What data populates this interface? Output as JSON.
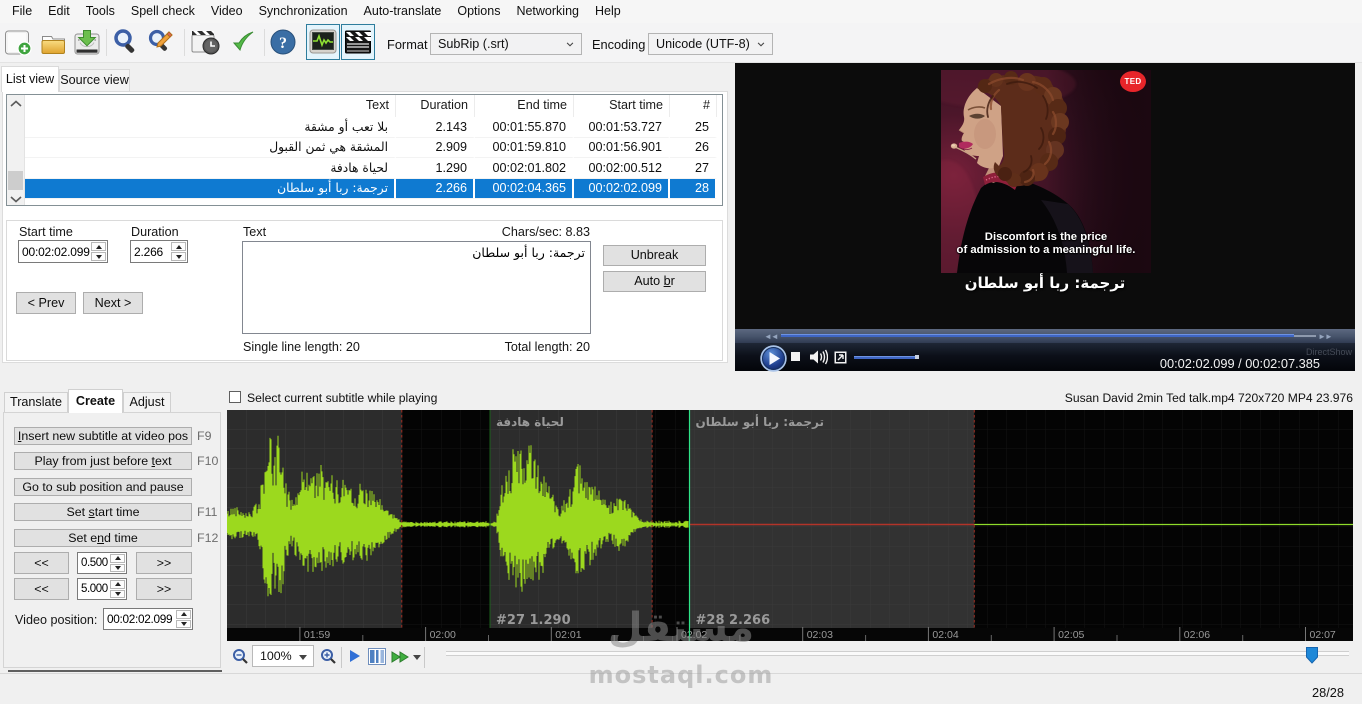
{
  "menu": {
    "items": [
      "File",
      "Edit",
      "Tools",
      "Spell check",
      "Video",
      "Synchronization",
      "Auto-translate",
      "Options",
      "Networking",
      "Help"
    ]
  },
  "toolbar": {
    "format_label": "Format",
    "format_value": "SubRip (.srt)",
    "encoding_label": "Encoding",
    "encoding_value": "Unicode (UTF-8)"
  },
  "view_tabs": {
    "list": "List view",
    "source": "Source view"
  },
  "listview": {
    "columns": [
      "Text",
      "Duration",
      "End time",
      "Start time",
      "#"
    ],
    "rows": [
      {
        "text": "بلا تعب أو مشقة",
        "duration": "2.143",
        "end": "00:01:55.870",
        "start": "00:01:53.727",
        "num": "25",
        "selected": false
      },
      {
        "text": "المشقة هي ثمن القبول",
        "duration": "2.909",
        "end": "00:01:59.810",
        "start": "00:01:56.901",
        "num": "26",
        "selected": false
      },
      {
        "text": "لحياة هادفة",
        "duration": "1.290",
        "end": "00:02:01.802",
        "start": "00:02:00.512",
        "num": "27",
        "selected": false
      },
      {
        "text": "ترجمة: ربا أبو سلطان",
        "duration": "2.266",
        "end": "00:02:04.365",
        "start": "00:02:02.099",
        "num": "28",
        "selected": true
      }
    ]
  },
  "editor": {
    "start_time_label": "Start time",
    "start_time": "00:02:02.099",
    "duration_label": "Duration",
    "duration": "2.266",
    "text_label": "Text",
    "chars_per_sec": "Chars/sec: 8.83",
    "text_value": "ترجمة: ربا أبو سلطان",
    "unbreak_label": "Unbreak",
    "auto_br_label": "Auto &br",
    "prev_label": "< Prev",
    "next_label": "Next >",
    "single_line_length": "Single line length: 20",
    "total_length": "Total length: 20"
  },
  "video": {
    "ted_logo": "TED",
    "caption_line1": "Discomfort is the price",
    "caption_line2": "of admission to a meaningful life.",
    "subtitle": "ترجمة: ربا أبو سلطان",
    "rewind_glyph": "◄◄",
    "forward_glyph": "►►",
    "time": "00:02:02.099 / 00:02:07.385",
    "renderer": "DirectShow",
    "progress_fraction": 0.959
  },
  "bottom_tabs": {
    "translate": "Translate",
    "create": "Create",
    "adjust": "Adjust"
  },
  "create_panel": {
    "buttons": [
      {
        "label": "&Insert new subtitle at video pos",
        "key": "F9"
      },
      {
        "label": "Play from just before &text",
        "key": "F10"
      },
      {
        "label": "Go to sub position and pause",
        "key": ""
      },
      {
        "label": "Set &start time",
        "key": "F11"
      },
      {
        "label": "Set e&nd time",
        "key": "F12"
      }
    ],
    "rewind_label": "<<",
    "forward_label": ">>",
    "small_step": "0.500",
    "big_step": "5.000",
    "video_position_label": "Video position:",
    "video_position": "00:02:02.099"
  },
  "wave": {
    "checkbox_label": "Select current subtitle while playing",
    "file_info": "Susan David 2min Ted talk.mp4 720x720 MP4 23.976",
    "zoom_value": "100%",
    "pixels_per_second": 125.7,
    "view_start_seconds": 118.42,
    "position_seconds": 122.099,
    "regions": [
      {
        "num": 26,
        "t_start": 116.901,
        "t_end": 119.81,
        "label": "",
        "info": "",
        "selected": false
      },
      {
        "num": 27,
        "t_start": 120.512,
        "t_end": 121.802,
        "label": "لحياة هادفة",
        "info": "#27  1.290",
        "selected": false
      },
      {
        "num": 28,
        "t_start": 122.099,
        "t_end": 124.365,
        "label": "ترجمة: ربا أبو سلطان",
        "info": "#28  2.266",
        "selected": true
      }
    ],
    "ticks": [
      {
        "t": 119,
        "label": "01:59"
      },
      {
        "t": 120,
        "label": "02:00"
      },
      {
        "t": 121,
        "label": "02:01"
      },
      {
        "t": 122,
        "label": "02:02"
      },
      {
        "t": 123,
        "label": "02:03"
      },
      {
        "t": 124,
        "label": "02:04"
      },
      {
        "t": 125,
        "label": "02:05"
      },
      {
        "t": 126,
        "label": "02:06"
      },
      {
        "t": 127,
        "label": "02:07"
      }
    ]
  },
  "status": {
    "count": "28/28"
  },
  "icons": {
    "help_glyph": "?"
  },
  "watermark": {
    "arabic": "مستقل",
    "latin": "mostaql.com"
  }
}
